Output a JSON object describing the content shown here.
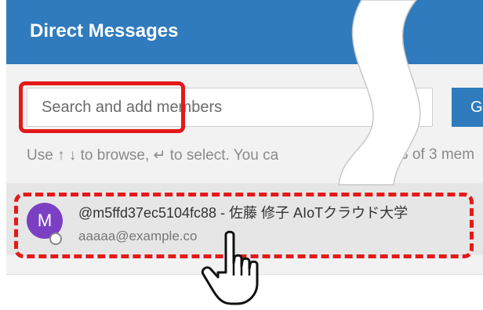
{
  "header": {
    "title": "Direct Messages"
  },
  "search": {
    "placeholder": "Search and add members",
    "value": "",
    "button_label": "G"
  },
  "hint": {
    "left": "Use ↑ ↓ to browse, ↵ to select. You ca",
    "right": "3 of 3 mem"
  },
  "results": [
    {
      "avatar_letter": "M",
      "name": "@m5ffd37ec5104fc88 - 佐藤 修子 AIoTクラウド大学",
      "email": "aaaaa@example.co"
    }
  ],
  "colors": {
    "header": "#2f7bbd",
    "avatar": "#7b3fc4",
    "highlight": "#e51919"
  },
  "icons": {
    "cursor": "hand-pointer-icon",
    "status": "status-circle-icon",
    "separator": "wave-separator"
  }
}
